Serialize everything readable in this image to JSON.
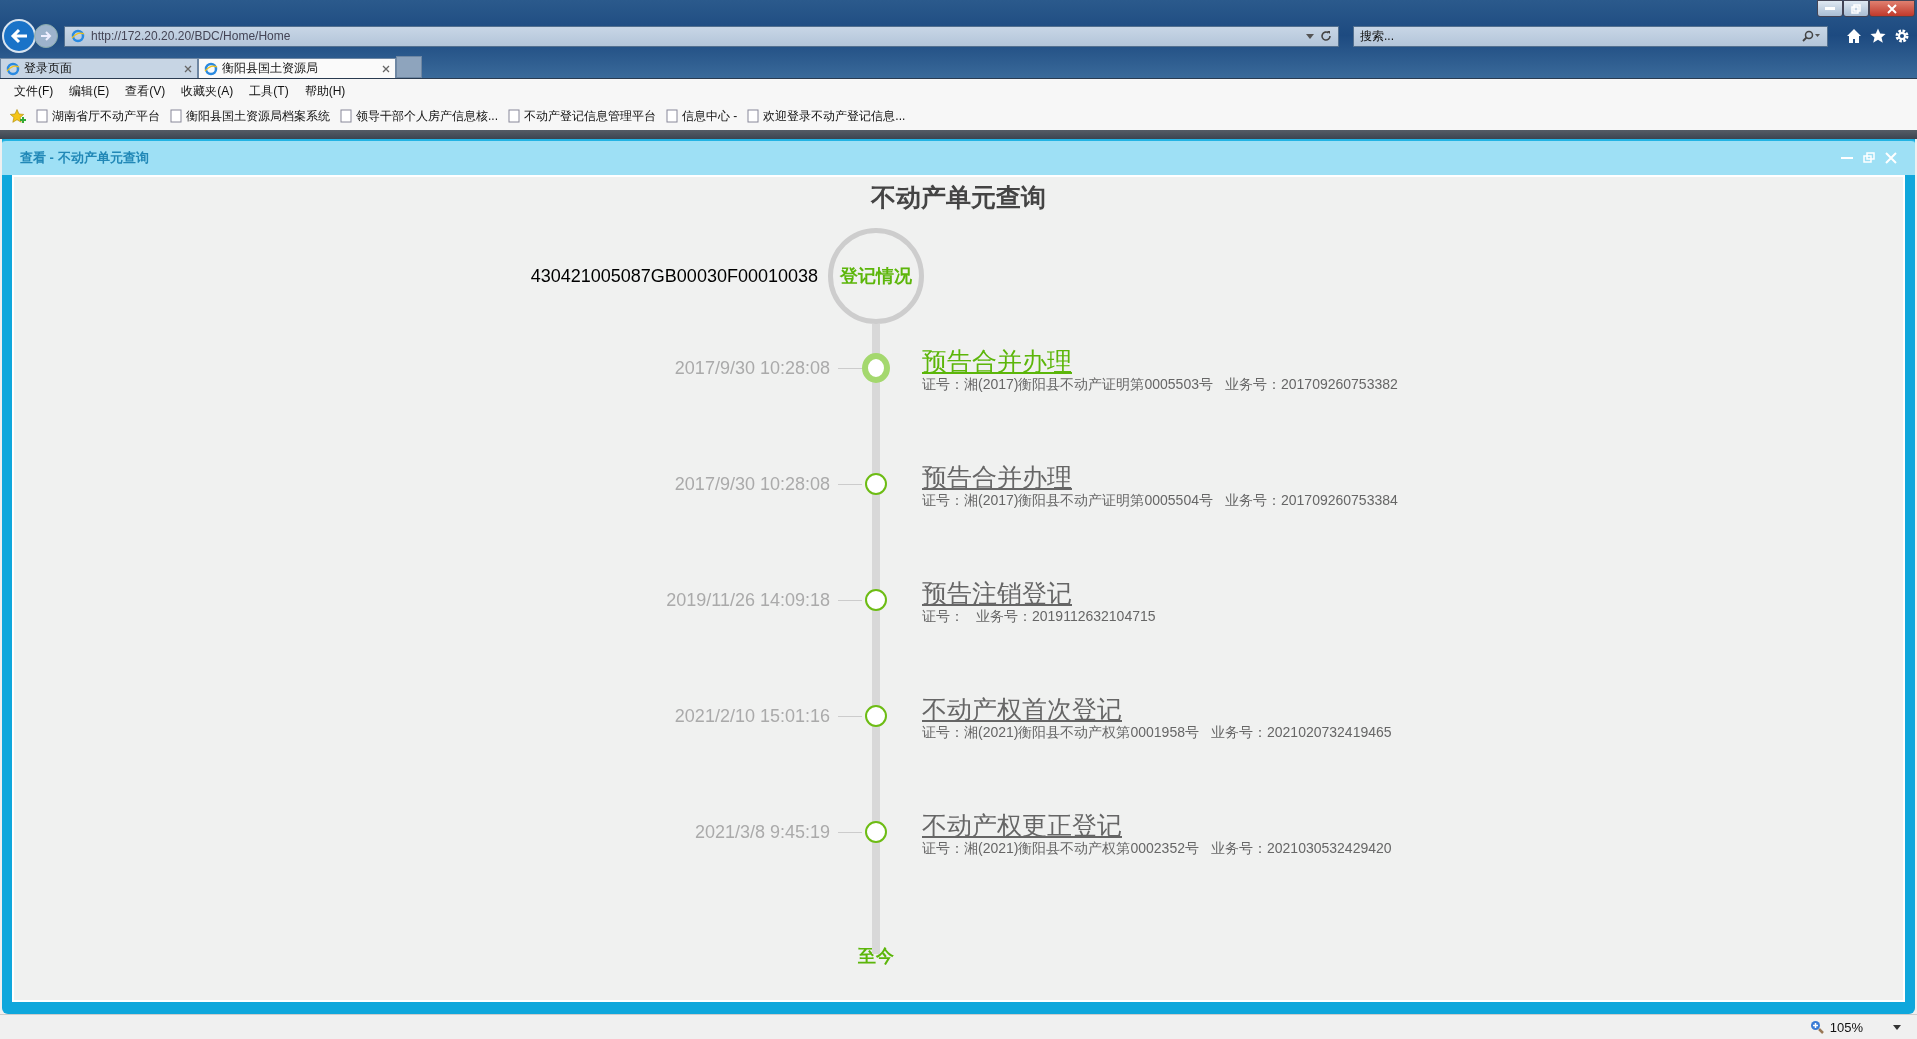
{
  "browser": {
    "url": "http://172.20.20.20/BDC/Home/Home",
    "search": {
      "placeholder": "搜索..."
    },
    "tabs": [
      {
        "label": "登录页面",
        "selected": false
      },
      {
        "label": "衡阳县国土资源局",
        "selected": true
      }
    ],
    "menu": [
      "文件(F)",
      "编辑(E)",
      "查看(V)",
      "收藏夹(A)",
      "工具(T)",
      "帮助(H)"
    ],
    "favorites": [
      "湖南省厅不动产平台",
      "衡阳县国土资源局档案系统",
      "领导干部个人房产信息核...",
      "不动产登记信息管理平台",
      "信息中心 -",
      "欢迎登录不动产登记信息..."
    ]
  },
  "dialog": {
    "title": "查看 - 不动产单元查询"
  },
  "page": {
    "heading": "不动产单元查询",
    "unit_id": "430421005087GB00030F00010038",
    "badge": "登记情况",
    "end_label": "至今"
  },
  "timeline": [
    {
      "time": "2017/9/30 10:28:08",
      "title": "预告合并办理",
      "cert": "证号：湘(2017)衡阳县不动产证明第0005503号",
      "business": "业务号：201709260753382",
      "selected": true
    },
    {
      "time": "2017/9/30 10:28:08",
      "title": "预告合并办理",
      "cert": "证号：湘(2017)衡阳县不动产证明第0005504号",
      "business": "业务号：201709260753384",
      "selected": false
    },
    {
      "time": "2019/11/26 14:09:18",
      "title": "预告注销登记",
      "cert": "证号：",
      "business": "业务号：2019112632104715",
      "selected": false
    },
    {
      "time": "2021/2/10 15:01:16",
      "title": "不动产权首次登记",
      "cert": "证号：湘(2021)衡阳县不动产权第0001958号",
      "business": "业务号：2021020732419465",
      "selected": false
    },
    {
      "time": "2021/3/8 9:45:19",
      "title": "不动产权更正登记",
      "cert": "证号：湘(2021)衡阳县不动产权第0002352号",
      "business": "业务号：2021030532429420",
      "selected": false
    }
  ],
  "status_bar": {
    "zoom": "105%"
  }
}
